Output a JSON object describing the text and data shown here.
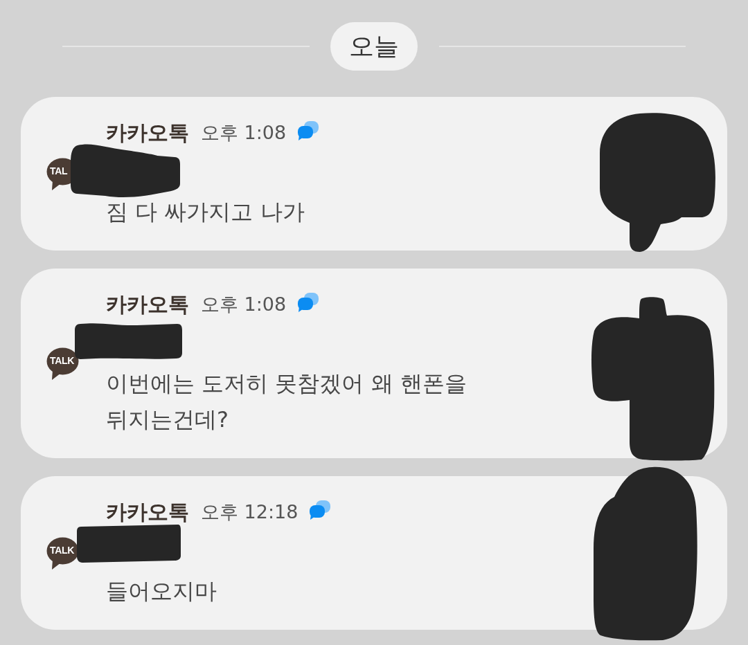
{
  "date_divider": {
    "label": "오늘"
  },
  "notifications": [
    {
      "logo_label": "TAL",
      "app_name": "카카오톡",
      "time": "오후 1:08",
      "sender_redacted": true,
      "message": "짐 다 싸가지고 나가",
      "photo_redacted": true
    },
    {
      "logo_label": "TALK",
      "app_name": "카카오톡",
      "time": "오후 1:08",
      "sender_redacted": true,
      "message": "이번에는 도저히 못참겠어 왜 핸폰을 뒤지는건데?",
      "photo_redacted": true
    },
    {
      "logo_label": "TALK",
      "app_name": "카카오톡",
      "time": "오후 12:18",
      "sender_redacted": true,
      "message": "들어오지마",
      "photo_redacted": true
    }
  ]
}
